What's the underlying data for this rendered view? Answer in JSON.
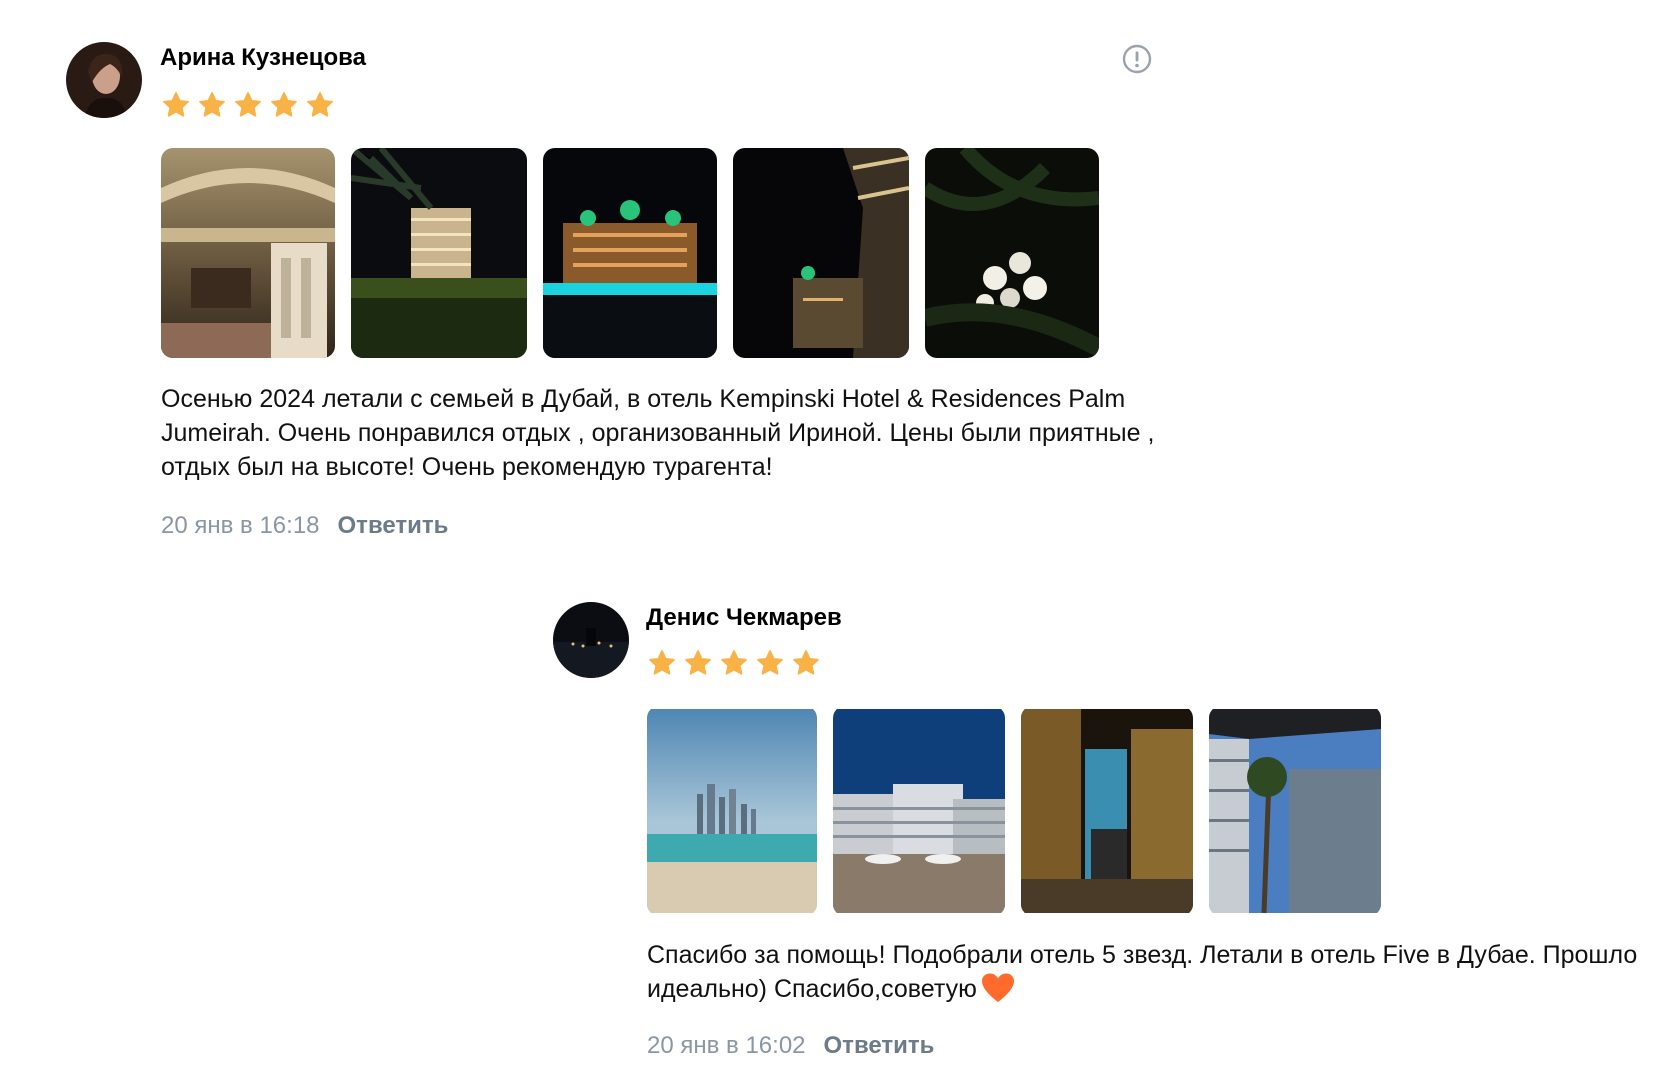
{
  "reviews": [
    {
      "author": "Арина Кузнецова",
      "rating": 5,
      "text": "Осенью 2024 летали с семьей в Дубай, в отель Kempinski Hotel & Residences Palm Jumeirah. Очень понравился отдых , организованный Ириной. Цены были приятные , отдых был на высоте! Очень рекомендую турагента!",
      "date": "20 янв в 16:18",
      "reply_label": "Ответить",
      "photo_count": 5
    },
    {
      "author": "Денис Чекмарев",
      "rating": 5,
      "text": "Спасибо за помощь! Подобрали отель 5 звезд. Летали в отель Five в Дубае. Прошло идеально) Спасибо,советую",
      "emoji": "orange-heart",
      "date": "20 янв в 16:02",
      "reply_label": "Ответить",
      "photo_count": 4
    }
  ],
  "icons": {
    "report": "exclamation-circle-icon",
    "star": "star-icon"
  },
  "colors": {
    "star": "#f8b245",
    "meta": "#8a96a3",
    "reply": "#6d7b89",
    "heart": "#ff6b2c"
  }
}
